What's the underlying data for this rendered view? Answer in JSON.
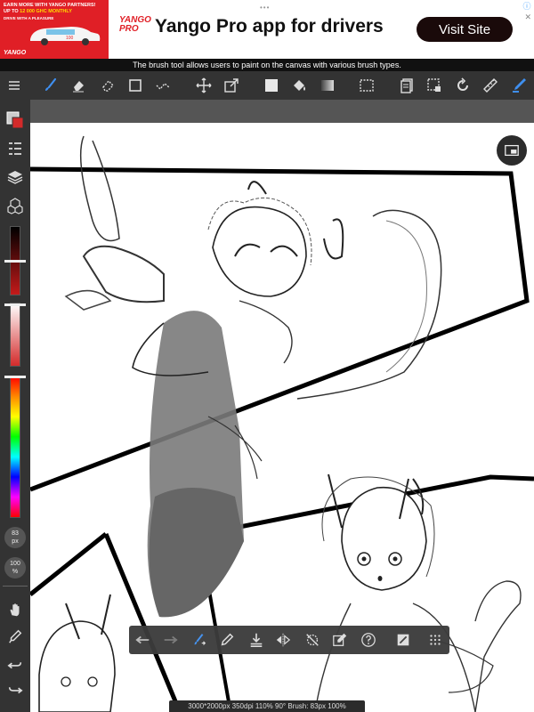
{
  "ad": {
    "promo_line1": "EARN MORE WITH YANGO PARTNERS!",
    "promo_line2_a": "UP TO ",
    "promo_line2_b": "12 000 GHC MONTHLY",
    "promo_line3": "DRIVE WITH A PLEASURE",
    "car_plate": "100",
    "brand_small": "YANGO",
    "logo_line1": "YANGO",
    "logo_line2": "PRO",
    "headline": "Yango Pro app for drivers",
    "cta": "Visit Site",
    "info_icon": "info-icon",
    "close_icon": "close-icon",
    "dots": "•••"
  },
  "tooltip": "The brush tool allows users to paint on the canvas with various brush types.",
  "toolbar": {
    "tools": [
      "menu-icon",
      "brush-icon",
      "eraser-icon",
      "blur-icon",
      "rectangle-icon",
      "selection-icon",
      "move-icon",
      "transform-icon",
      "fill-color-icon",
      "bucket-icon",
      "gradient-icon",
      "lasso-icon",
      "layers-icon",
      "select-layer-icon",
      "rotate-icon",
      "ruler-icon",
      "pen-icon"
    ]
  },
  "left_panel": {
    "brush_size_label": "83",
    "brush_size_unit": "px",
    "opacity_label": "100",
    "opacity_unit": "%",
    "primary_color": "#d32a2a",
    "secondary_color": "#ffffff"
  },
  "status_bar": "3000*2000px 350dpi 110% 90° Brush: 83px 100%",
  "bottom_toolbar": {
    "tools": [
      "undo-icon",
      "redo-icon",
      "brush-sync-icon",
      "pencil-icon",
      "import-icon",
      "flip-icon",
      "lasso-off-icon",
      "edit-icon",
      "help-icon",
      "reference-icon",
      "grid-icon"
    ]
  },
  "colors": {
    "toolbar_bg": "#333333",
    "accent": "#3f8ff0",
    "ad_red": "#e01f26"
  }
}
